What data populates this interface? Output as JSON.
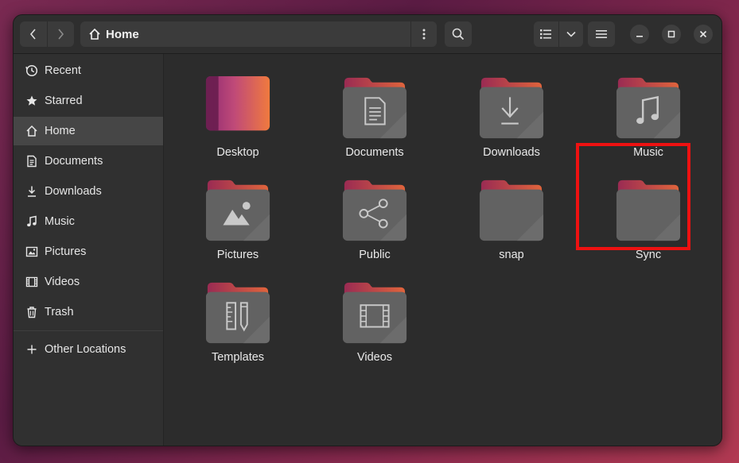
{
  "window": {
    "title": "Home"
  },
  "header": {
    "back_icon": "chevron-left-icon",
    "forward_icon": "chevron-right-icon",
    "path_label": "Home",
    "path_icon": "home-icon",
    "path_menu_icon": "vertical-dots-icon",
    "search_icon": "search-icon",
    "view_icon": "list-view-icon",
    "view_dropdown_icon": "chevron-down-icon",
    "main_menu_icon": "hamburger-icon",
    "minimize_icon": "minimize-icon",
    "maximize_icon": "maximize-icon",
    "close_icon": "close-icon"
  },
  "sidebar": {
    "items": [
      {
        "label": "Recent",
        "icon": "clock-icon"
      },
      {
        "label": "Starred",
        "icon": "star-icon"
      },
      {
        "label": "Home",
        "icon": "home-icon",
        "active": true
      },
      {
        "label": "Documents",
        "icon": "document-icon"
      },
      {
        "label": "Downloads",
        "icon": "download-icon"
      },
      {
        "label": "Music",
        "icon": "music-note-icon"
      },
      {
        "label": "Pictures",
        "icon": "picture-icon"
      },
      {
        "label": "Videos",
        "icon": "film-icon"
      },
      {
        "label": "Trash",
        "icon": "trash-icon"
      },
      {
        "label": "Other Locations",
        "icon": "plus-icon"
      }
    ]
  },
  "files": [
    {
      "label": "Desktop",
      "icon": "desktop-folder-icon"
    },
    {
      "label": "Documents",
      "icon": "documents-folder-icon"
    },
    {
      "label": "Downloads",
      "icon": "downloads-folder-icon"
    },
    {
      "label": "Music",
      "icon": "music-folder-icon"
    },
    {
      "label": "Pictures",
      "icon": "pictures-folder-icon"
    },
    {
      "label": "Public",
      "icon": "public-folder-icon"
    },
    {
      "label": "snap",
      "icon": "folder-icon"
    },
    {
      "label": "Sync",
      "icon": "folder-icon",
      "highlighted": true
    },
    {
      "label": "Templates",
      "icon": "templates-folder-icon"
    },
    {
      "label": "Videos",
      "icon": "videos-folder-icon"
    }
  ],
  "colors": {
    "highlight": "#ee1111",
    "folder_body": "#5f5f5f",
    "folder_tab": "#8a2a4e",
    "accent_orange": "#e9733c"
  }
}
